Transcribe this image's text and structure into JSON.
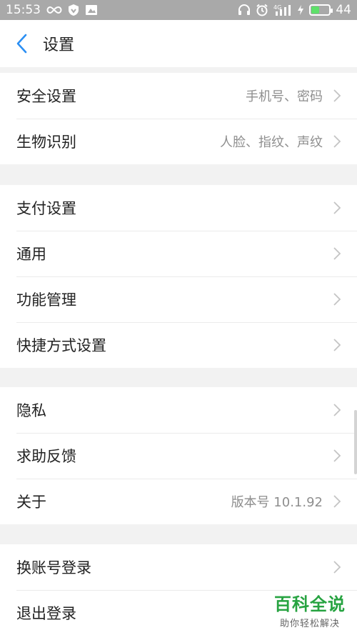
{
  "status_bar": {
    "time": "15:53",
    "signal": "4G",
    "battery": "44",
    "battery_level": 0.44
  },
  "header": {
    "title": "设置"
  },
  "groups": [
    {
      "items": [
        {
          "label": "安全设置",
          "value": "手机号、密码"
        },
        {
          "label": "生物识别",
          "value": "人脸、指纹、声纹"
        }
      ]
    },
    {
      "items": [
        {
          "label": "支付设置",
          "value": ""
        },
        {
          "label": "通用",
          "value": ""
        },
        {
          "label": "功能管理",
          "value": ""
        },
        {
          "label": "快捷方式设置",
          "value": ""
        }
      ]
    },
    {
      "items": [
        {
          "label": "隐私",
          "value": ""
        },
        {
          "label": "求助反馈",
          "value": ""
        },
        {
          "label": "关于",
          "value": "版本号 10.1.92"
        }
      ]
    },
    {
      "items": [
        {
          "label": "换账号登录",
          "value": ""
        },
        {
          "label": "退出登录",
          "value": ""
        }
      ]
    }
  ],
  "watermark": {
    "title": "百科全说",
    "subtitle": "助你轻松解决"
  },
  "colors": {
    "accent": "#2b8ff3",
    "watermark": "#27a341"
  }
}
